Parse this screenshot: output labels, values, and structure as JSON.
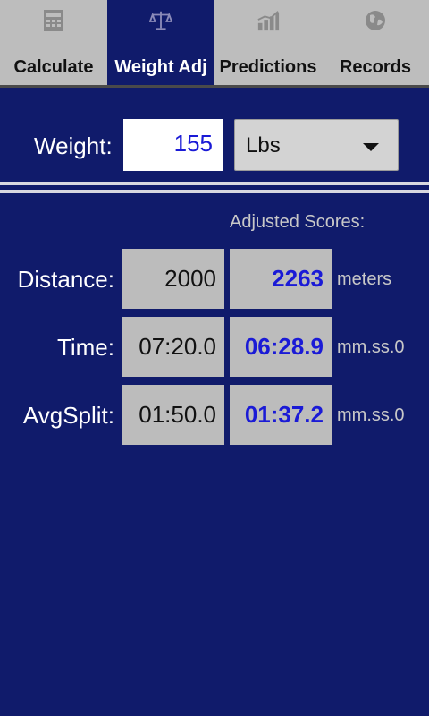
{
  "tabs": [
    {
      "label": "Calculate",
      "icon": "calculator-icon"
    },
    {
      "label": "Weight Adj",
      "icon": "scale-icon"
    },
    {
      "label": "Predictions",
      "icon": "chart-icon"
    },
    {
      "label": "Records",
      "icon": "globe-icon"
    }
  ],
  "active_tab": "Weight Adj",
  "weight": {
    "label": "Weight:",
    "value": "155",
    "unit": "Lbs"
  },
  "adjusted_header": "Adjusted Scores:",
  "rows": [
    {
      "label": "Distance:",
      "input": "2000",
      "adjusted": "2263",
      "unit": "meters"
    },
    {
      "label": "Time:",
      "input": "07:20.0",
      "adjusted": "06:28.9",
      "unit": "mm.ss.0"
    },
    {
      "label": "AvgSplit:",
      "input": "01:50.0",
      "adjusted": "01:37.2",
      "unit": "mm.ss.0"
    }
  ],
  "colors": {
    "background": "#101b6b",
    "tabbar": "#bdbdbd",
    "accent_text": "#1a1ad6",
    "cell": "#bcbcbc"
  }
}
